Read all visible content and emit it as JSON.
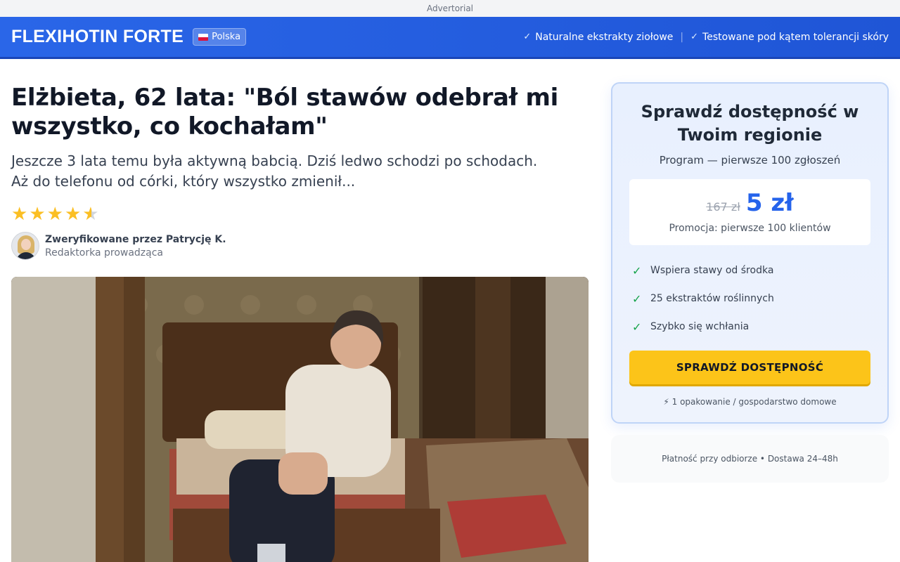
{
  "advert": {
    "label": "Advertorial"
  },
  "header": {
    "brand": "FLEXIHOTIN FORTE",
    "region": "Polska",
    "badges": [
      "Naturalne ekstrakty ziołowe",
      "Testowane pod kątem tolerancji skóry"
    ],
    "separator": "|"
  },
  "article": {
    "headline": "Elżbieta, 62 lata: \"Ból stawów odebrał mi wszystko, co kochałam\"",
    "lead_line1": "Jeszcze 3 lata temu była aktywną babcią. Dziś ledwo schodzi po schodach.",
    "lead_line2": "Aż do telefonu od córki, który wszystko zmienił...",
    "rating": 4.5,
    "author": {
      "name": "Zweryfikowane przez Patrycję K.",
      "role": "Redaktorka prowadząca"
    }
  },
  "offer": {
    "title": "Sprawdź dostępność w Twoim regionie",
    "subtitle": "Program — pierwsze 100 zgłoszeń",
    "old_price": "167 zł",
    "new_price": "5 zł",
    "promo": "Promocja: pierwsze 100 klientów",
    "benefits": [
      "Wspiera stawy od środka",
      "25 ekstraktów roślinnych",
      "Szybko się wchłania"
    ],
    "cta_label": "SPRAWDŹ DOSTĘPNOŚĆ",
    "cta_note": "⚡ 1 opakowanie / gospodarstwo domowe",
    "payment_info": "Płatność przy odbiorze • Dostawa 24–48h"
  },
  "colors": {
    "header_blue": "#2a66e8",
    "price_blue": "#2563eb",
    "cta_yellow": "#fcc419",
    "star_gold": "#fbbf24",
    "check_green": "#16a34a"
  },
  "icons": [
    "check-icon",
    "poland-flag-icon",
    "star-icon",
    "lightning-icon"
  ]
}
